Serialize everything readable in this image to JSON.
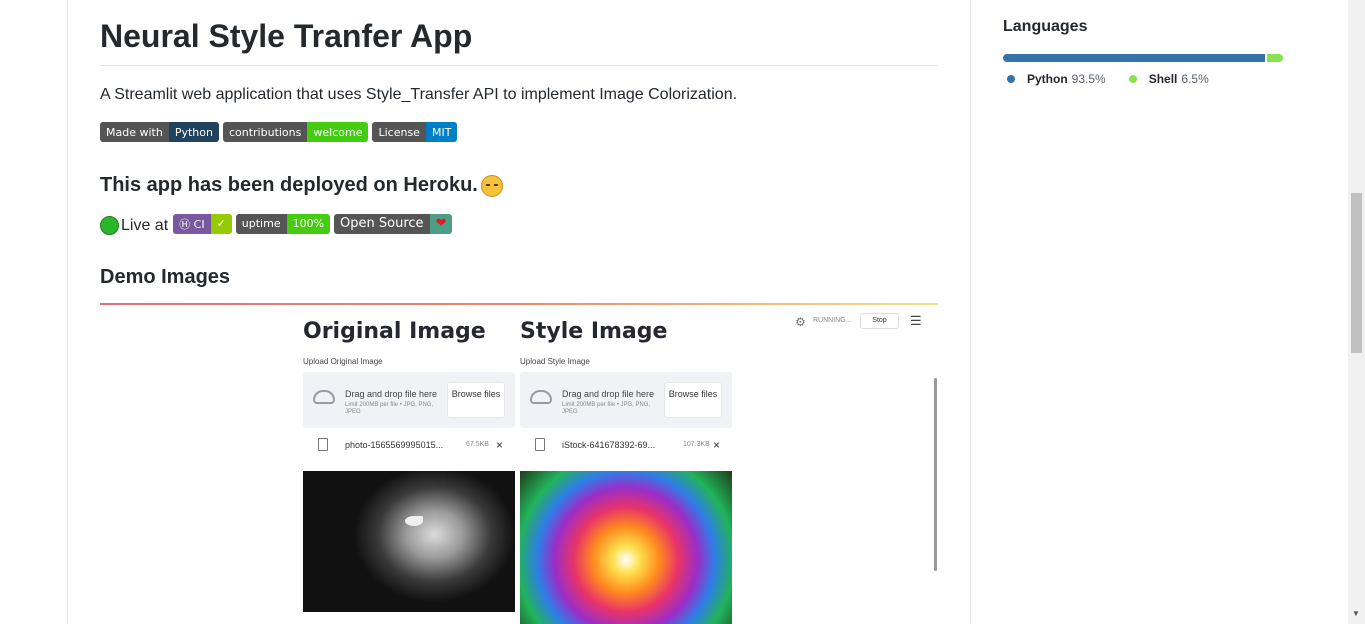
{
  "readme": {
    "title": "Neural Style Tranfer App",
    "description": "A Streamlit web application that uses Style_Transfer API to implement Image Colorization.",
    "badges": [
      {
        "left": "Made with",
        "right": "Python"
      },
      {
        "left": "contributions",
        "right": "welcome"
      },
      {
        "left": "License",
        "right": "MIT"
      }
    ],
    "deployed_heading": "This app has been deployed on Heroku.",
    "live_text": "Live at",
    "live_badges": [
      {
        "left": "Ⓗ CI",
        "right": "✓"
      },
      {
        "left": "uptime",
        "right": "100%"
      },
      {
        "left": "Open Source",
        "right": "❤"
      }
    ],
    "demo_heading": "Demo Images"
  },
  "demo_screenshot": {
    "left_panel": {
      "heading": "Original Image",
      "upload_label": "Upload Original Image",
      "drop_text": "Drag and drop file here",
      "limit_text": "Limit 200MB per file • JPG, PNG, JPEG",
      "browse": "Browse files",
      "file_name": "photo-1565569995015...",
      "file_size": "67.5KB"
    },
    "right_panel": {
      "heading": "Style Image",
      "upload_label": "Upload Style Image",
      "drop_text": "Drag and drop file here",
      "limit_text": "Limit 200MB per file • JPG, PNG, JPEG",
      "browse": "Browse files",
      "file_name": "iStock-641678392-69...",
      "file_size": "107.3KB"
    },
    "running_text": "RUNNING...",
    "stop_label": "Stop",
    "menu_icon": "hamburger-icon",
    "remove_icon": "×"
  },
  "sidebar": {
    "languages_title": "Languages",
    "languages": [
      {
        "name": "Python",
        "percent": "93.5%",
        "value": 93.5,
        "color": "#3572a5"
      },
      {
        "name": "Shell",
        "percent": "6.5%",
        "value": 6.5,
        "color": "#89e051"
      }
    ]
  }
}
